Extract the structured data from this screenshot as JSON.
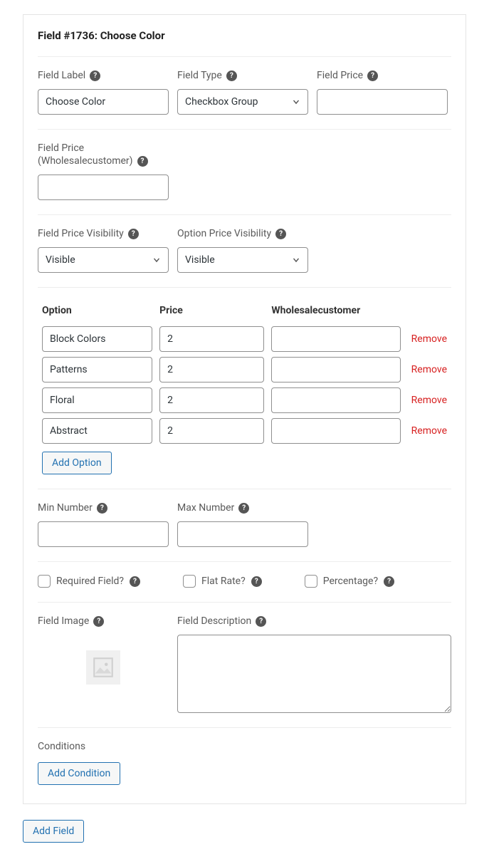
{
  "header": {
    "title": "Field #1736: Choose Color"
  },
  "labels": {
    "field_label": "Field Label",
    "field_type": "Field Type",
    "field_price": "Field Price",
    "field_price_wholesale_line1": "Field Price",
    "field_price_wholesale_line2": "(Wholesalecustomer)",
    "field_price_visibility": "Field Price Visibility",
    "option_price_visibility": "Option Price Visibility",
    "option": "Option",
    "price": "Price",
    "wholesale": "Wholesalecustomer",
    "remove": "Remove",
    "add_option": "Add Option",
    "min_number": "Min Number",
    "max_number": "Max Number",
    "required_field": "Required Field?",
    "flat_rate": "Flat Rate?",
    "percentage": "Percentage?",
    "field_image": "Field Image",
    "field_description": "Field Description",
    "conditions": "Conditions",
    "add_condition": "Add Condition",
    "add_field": "Add Field"
  },
  "values": {
    "field_label": "Choose Color",
    "field_type": "Checkbox Group",
    "field_price": "",
    "field_price_wholesale": "",
    "field_price_visibility": "Visible",
    "option_price_visibility": "Visible",
    "min_number": "",
    "max_number": "",
    "field_description": ""
  },
  "select_options": {
    "field_type": [
      "Checkbox Group"
    ],
    "visibility": [
      "Visible"
    ]
  },
  "options": [
    {
      "option": "Block Colors",
      "price": "2",
      "wholesale": ""
    },
    {
      "option": "Patterns",
      "price": "2",
      "wholesale": ""
    },
    {
      "option": "Floral",
      "price": "2",
      "wholesale": ""
    },
    {
      "option": "Abstract",
      "price": "2",
      "wholesale": ""
    }
  ],
  "checks": {
    "required_field": false,
    "flat_rate": false,
    "percentage": false
  }
}
